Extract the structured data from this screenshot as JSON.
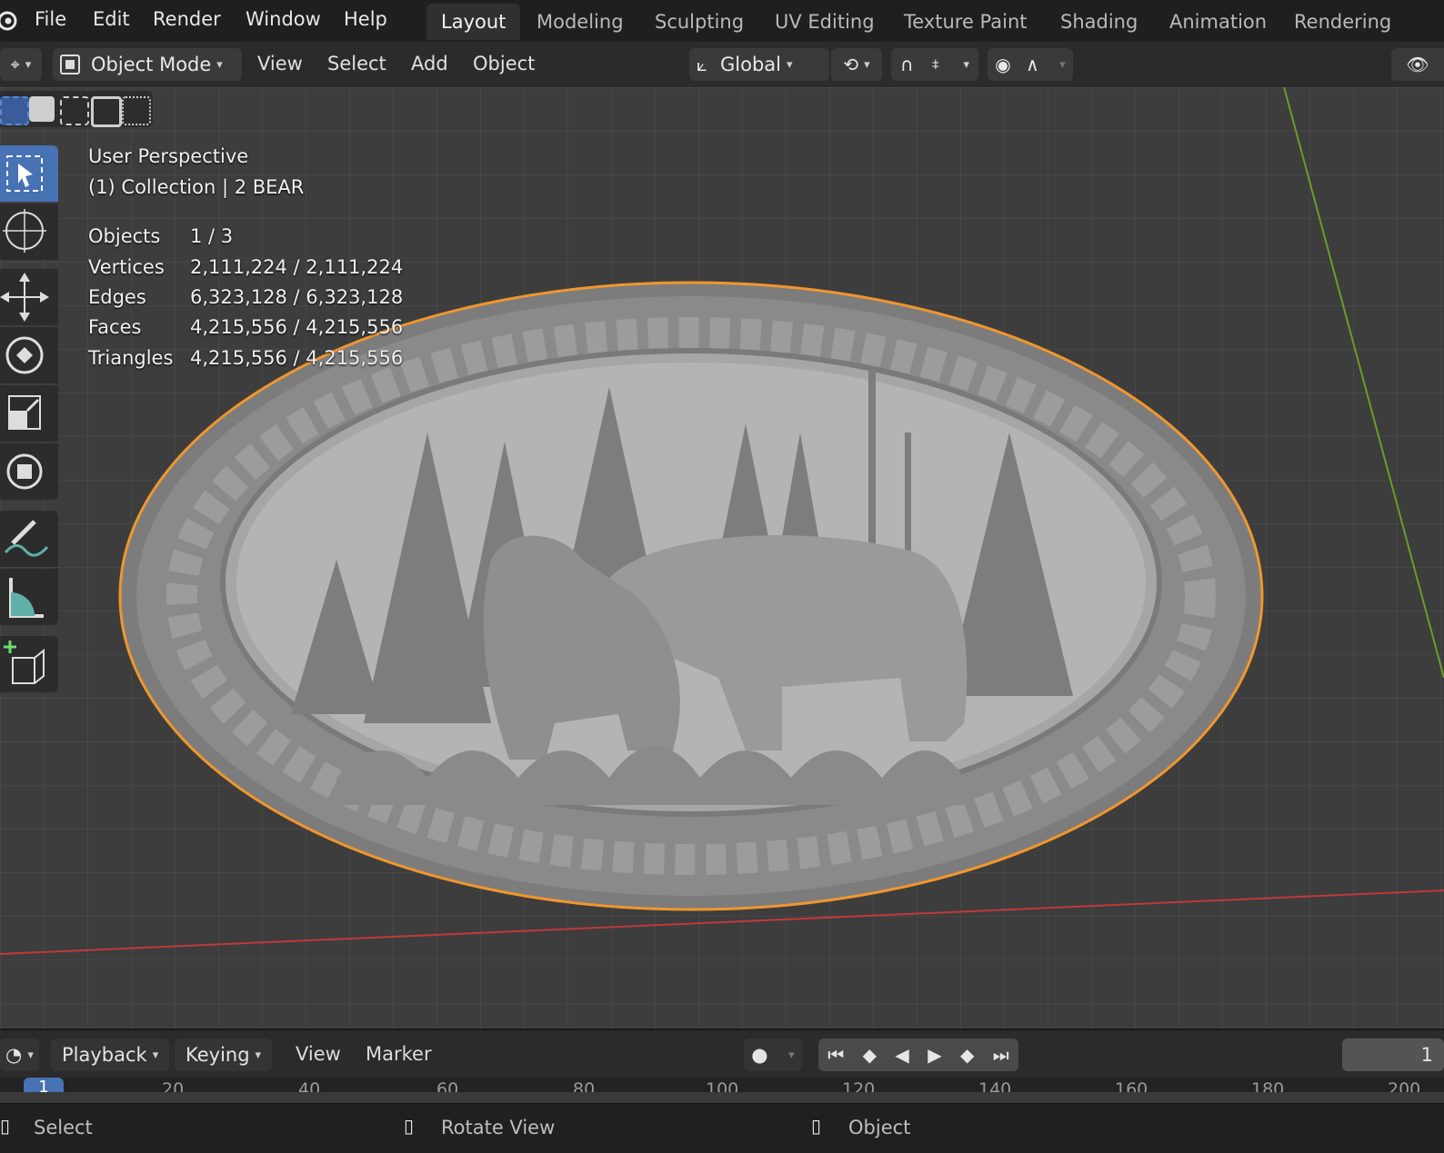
{
  "topbar": {
    "menus": [
      "File",
      "Edit",
      "Render",
      "Window",
      "Help"
    ],
    "workspaces": [
      "Layout",
      "Modeling",
      "Sculpting",
      "UV Editing",
      "Texture Paint",
      "Shading",
      "Animation",
      "Rendering"
    ],
    "active_workspace": "Layout"
  },
  "header": {
    "mode": "Object Mode",
    "menus": [
      "View",
      "Select",
      "Add",
      "Object"
    ],
    "orientation": "Global"
  },
  "overlay": {
    "view_name": "User Perspective",
    "collection": "(1) Collection | 2 BEAR",
    "stats": [
      {
        "label": "Objects",
        "value": "1 / 3"
      },
      {
        "label": "Vertices",
        "value": "2,111,224 / 2,111,224"
      },
      {
        "label": "Edges",
        "value": "6,323,128 / 6,323,128"
      },
      {
        "label": "Faces",
        "value": "4,215,556 / 4,215,556"
      },
      {
        "label": "Triangles",
        "value": "4,215,556 / 4,215,556"
      }
    ]
  },
  "timeline": {
    "playback": "Playback",
    "keying": "Keying",
    "view": "View",
    "marker": "Marker",
    "current_frame": "1",
    "ruler_current": "1",
    "ticks": [
      "20",
      "40",
      "60",
      "80",
      "100",
      "120",
      "140",
      "160",
      "180",
      "200"
    ]
  },
  "statusbar": {
    "left": "Select",
    "middle": "Rotate View",
    "right": "Object"
  },
  "colors": {
    "selection_outline": "#f0962e",
    "x_axis": "#c0393b",
    "y_axis": "#6f9a2a",
    "active_tool": "#4772b3"
  }
}
